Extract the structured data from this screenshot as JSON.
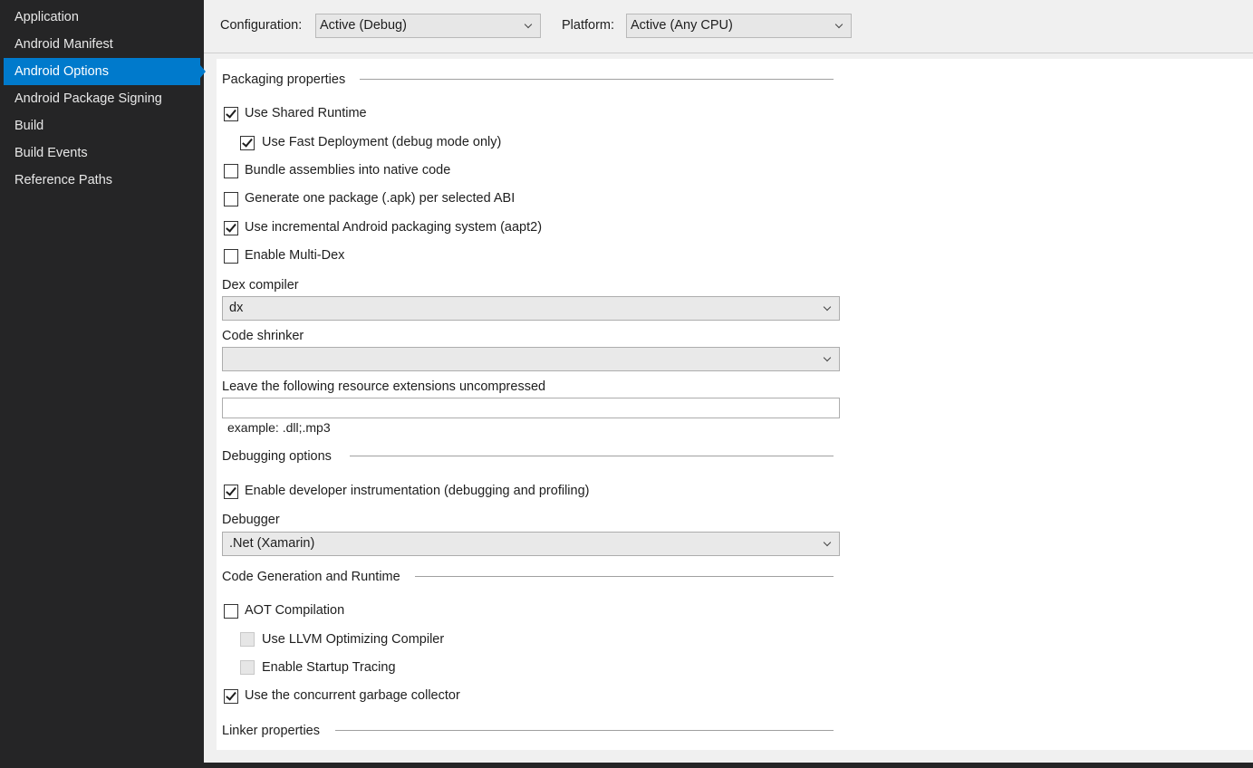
{
  "sidebar": {
    "items": [
      {
        "label": "Application"
      },
      {
        "label": "Android Manifest"
      },
      {
        "label": "Android Options",
        "active": true
      },
      {
        "label": "Android Package Signing"
      },
      {
        "label": "Build"
      },
      {
        "label": "Build Events"
      },
      {
        "label": "Reference Paths"
      }
    ]
  },
  "header": {
    "configuration_label": "Configuration:",
    "configuration_value": "Active (Debug)",
    "platform_label": "Platform:",
    "platform_value": "Active (Any CPU)"
  },
  "packaging": {
    "title": "Packaging properties",
    "use_shared_runtime": {
      "label": "Use Shared Runtime",
      "checked": true
    },
    "use_fast_deployment": {
      "label": "Use Fast Deployment (debug mode only)",
      "checked": true
    },
    "bundle_assemblies": {
      "label": "Bundle assemblies into native code",
      "checked": false
    },
    "one_package_per_abi": {
      "label": "Generate one package (.apk) per selected ABI",
      "checked": false
    },
    "incremental_packaging": {
      "label": "Use incremental Android packaging system (aapt2)",
      "checked": true
    },
    "multi_dex": {
      "label": "Enable Multi-Dex",
      "checked": false
    },
    "dex_compiler": {
      "label": "Dex compiler",
      "value": "dx"
    },
    "code_shrinker": {
      "label": "Code shrinker",
      "value": ""
    },
    "uncompressed_ext": {
      "label": "Leave the following resource extensions uncompressed",
      "value": "",
      "hint": "example: .dll;.mp3"
    }
  },
  "debugging": {
    "title": "Debugging options",
    "developer_instrumentation": {
      "label": "Enable developer instrumentation (debugging and profiling)",
      "checked": true
    },
    "debugger": {
      "label": "Debugger",
      "value": ".Net (Xamarin)"
    }
  },
  "codegen": {
    "title": "Code Generation and Runtime",
    "aot": {
      "label": "AOT Compilation",
      "checked": false
    },
    "llvm": {
      "label": "Use LLVM Optimizing Compiler",
      "checked": false,
      "disabled": true
    },
    "startup_tracing": {
      "label": "Enable Startup Tracing",
      "checked": false,
      "disabled": true
    },
    "concurrent_gc": {
      "label": "Use the concurrent garbage collector",
      "checked": true
    }
  },
  "linker": {
    "title": "Linker properties"
  },
  "colors": {
    "sidebar_bg": "#252526",
    "accent": "#007acc",
    "panel_bg": "#ffffff",
    "page_bg": "#f0f0f0"
  }
}
